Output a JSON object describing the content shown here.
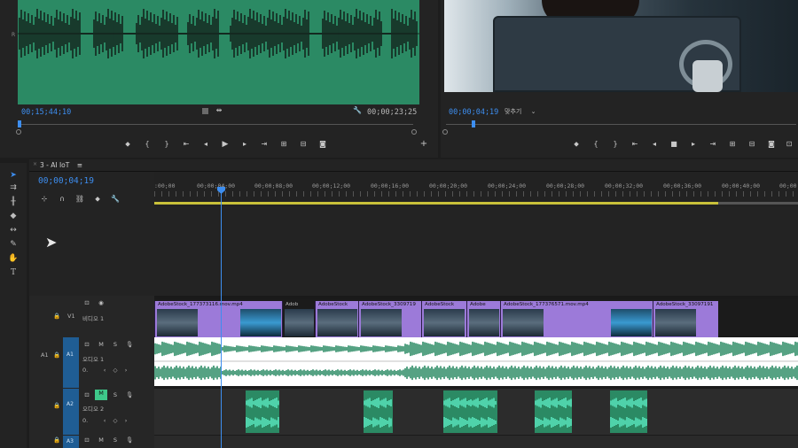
{
  "source": {
    "tc_left": "00;15;44;10",
    "tc_right": "00;00;23;25",
    "ruler_mark": "R"
  },
  "program": {
    "tc": "00;00;04;19",
    "fit": "맞추기",
    "fit_arrow": "⌄"
  },
  "timeline": {
    "tab": "3 - AI IoT",
    "tab_menu": "≡",
    "tc": "00;00;04;19",
    "ruler_ticks": [
      ":00;00",
      "00;00;04;00",
      "00;00;08;00",
      "00;00;12;00",
      "00;00;16;00",
      "00;00;20;00",
      "00;00;24;00",
      "00;00;28;00",
      "00;00;32;00",
      "00;00;36;00",
      "00;00;40;00",
      "00;00"
    ],
    "tracks": {
      "v1": {
        "id": "V1",
        "name": "비디오 1"
      },
      "a1": {
        "id": "A1",
        "src": "A1",
        "name": "오디오 1",
        "vol": "0."
      },
      "a2": {
        "id": "A2",
        "name": "오디오 2",
        "vol": "0."
      },
      "a3": {
        "id": "A3"
      }
    },
    "btn_m": "M",
    "btn_s": "S",
    "video_clips": [
      "AdobeStock_177373116.mov.mp4",
      "Adob",
      "AdobeStock",
      "AdobeStock_3309719",
      "AdobeStock",
      "Adobe",
      "AdobeStock_177376571.mov.mp4",
      "AdobeStock_33097191"
    ]
  },
  "colors": {
    "accent": "#3d8ef0",
    "audio_clip": "#2b8a64",
    "video_clip": "#9c7ad9",
    "workarea": "#c9c13a"
  }
}
